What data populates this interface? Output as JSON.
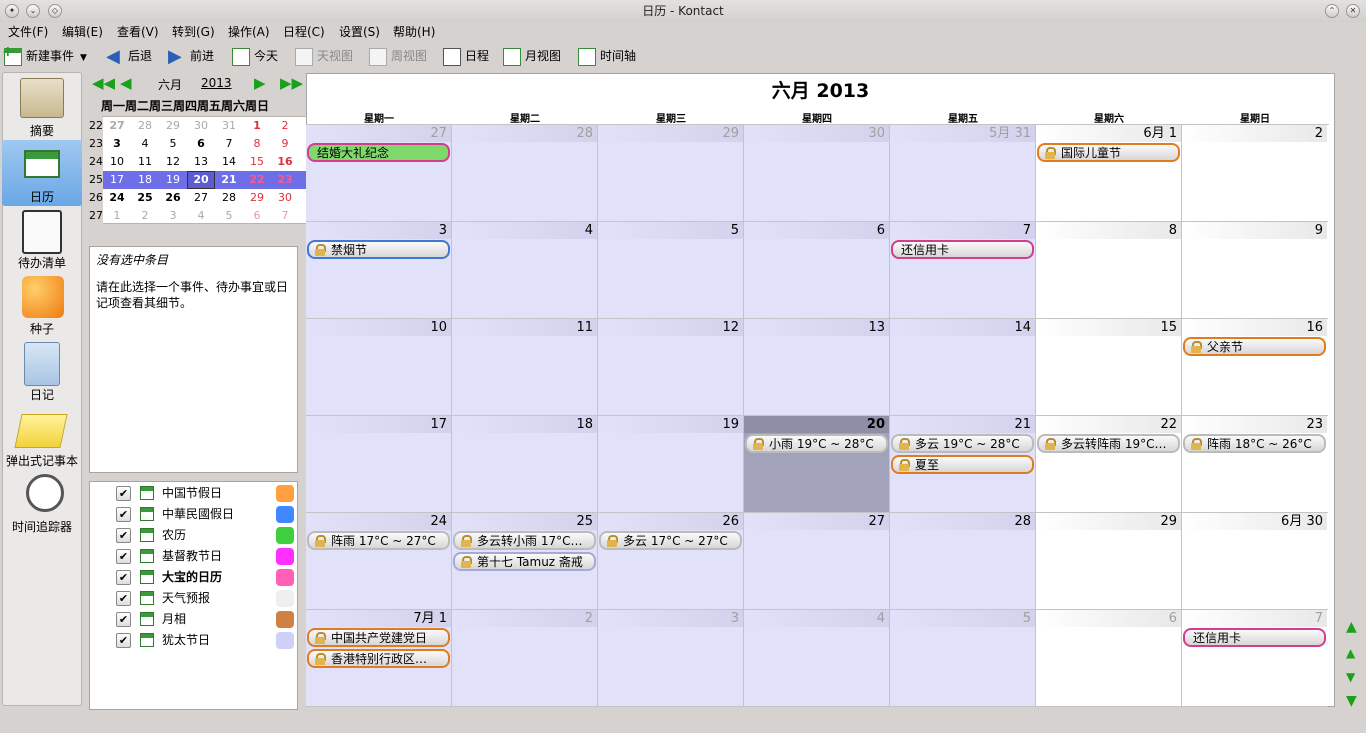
{
  "window": {
    "title": "日历 - Kontact"
  },
  "menu": [
    "文件(F)",
    "编辑(E)",
    "查看(V)",
    "转到(G)",
    "操作(A)",
    "日程(C)",
    "设置(S)",
    "帮助(H)"
  ],
  "toolbar": {
    "new_event": "新建事件",
    "back": "后退",
    "forward": "前进",
    "today": "今天",
    "day_view": "天视图",
    "week_view": "周视图",
    "agenda": "日程",
    "month_view": "月视图",
    "timeline": "时间轴"
  },
  "sidebar": [
    {
      "label": "摘要",
      "icon": "summary-icon"
    },
    {
      "label": "日历",
      "icon": "calendar-icon",
      "selected": true
    },
    {
      "label": "待办清单",
      "icon": "todo-icon"
    },
    {
      "label": "种子",
      "icon": "feed-icon"
    },
    {
      "label": "日记",
      "icon": "journal-icon"
    },
    {
      "label": "弹出式记事本",
      "icon": "notes-icon"
    },
    {
      "label": "时间追踪器",
      "icon": "timetracker-icon"
    }
  ],
  "mini_calendar": {
    "month": "六月",
    "year": "2013",
    "weekday_header": "周一周二周三周四周五周六周日",
    "weeks": [
      {
        "wk": "22",
        "days": [
          "27",
          "28",
          "29",
          "30",
          "31",
          "1",
          "2"
        ]
      },
      {
        "wk": "23",
        "days": [
          "3",
          "4",
          "5",
          "6",
          "7",
          "8",
          "9"
        ]
      },
      {
        "wk": "24",
        "days": [
          "10",
          "11",
          "12",
          "13",
          "14",
          "15",
          "16"
        ]
      },
      {
        "wk": "25",
        "days": [
          "17",
          "18",
          "19",
          "20",
          "21",
          "22",
          "23"
        ]
      },
      {
        "wk": "26",
        "days": [
          "24",
          "25",
          "26",
          "27",
          "28",
          "29",
          "30"
        ]
      },
      {
        "wk": "27",
        "days": [
          "1",
          "2",
          "3",
          "4",
          "5",
          "6",
          "7"
        ]
      }
    ]
  },
  "details": {
    "title": "没有选中条目",
    "line1": "请在此选择一个事件、待办事宜或日",
    "line2": "记项查看其细节。"
  },
  "calendars": [
    {
      "name": "中国节假日",
      "color": "#ff9f3f",
      "checked": true
    },
    {
      "name": "中華民國假日",
      "color": "#3f88ff",
      "checked": true
    },
    {
      "name": "农历",
      "color": "#3fce3f",
      "checked": true
    },
    {
      "name": "基督教节日",
      "color": "#ff30ff",
      "checked": true
    },
    {
      "name": "大宝的日历",
      "color": "#ff5fb4",
      "checked": true,
      "bold": true
    },
    {
      "name": "天气预报",
      "color": "#efefef",
      "checked": true
    },
    {
      "name": "月相",
      "color": "#d08040",
      "checked": true
    },
    {
      "name": "犹太节日",
      "color": "#cfcff7",
      "checked": true
    }
  ],
  "month_view": {
    "title": "六月 2013",
    "weekdays": [
      "星期一",
      "星期二",
      "星期三",
      "星期四",
      "星期五",
      "星期六",
      "星期日"
    ],
    "weeks": [
      [
        "27",
        "28",
        "29",
        "30",
        "5月 31",
        "6月 1",
        "2"
      ],
      [
        "3",
        "4",
        "5",
        "6",
        "7",
        "8",
        "9"
      ],
      [
        "10",
        "11",
        "12",
        "13",
        "14",
        "15",
        "16"
      ],
      [
        "17",
        "18",
        "19",
        "20",
        "21",
        "22",
        "23"
      ],
      [
        "24",
        "25",
        "26",
        "27",
        "28",
        "29",
        "6月 30"
      ],
      [
        "7月 1",
        "2",
        "3",
        "4",
        "5",
        "6",
        "7"
      ]
    ],
    "events": [
      {
        "week": 0,
        "day": 0,
        "slot": 0,
        "text": "结婚大礼纪念",
        "border": "#d63c8c",
        "bg": "#7fd86c",
        "lock": false
      },
      {
        "week": 0,
        "day": 5,
        "slot": 0,
        "text": "国际儿童节",
        "border": "#e07b1f",
        "lock": true
      },
      {
        "week": 1,
        "day": 0,
        "slot": 0,
        "text": "禁烟节",
        "border": "#3f78d8",
        "lock": true
      },
      {
        "week": 1,
        "day": 4,
        "slot": 0,
        "text": "还信用卡",
        "border": "#d63c8c",
        "lock": false
      },
      {
        "week": 2,
        "day": 6,
        "slot": 0,
        "text": "父亲节",
        "border": "#e07b1f",
        "lock": true
      },
      {
        "week": 3,
        "day": 3,
        "slot": 0,
        "text": "小雨 19°C ~ 28°C",
        "border": "#bbbbbb",
        "lock": true
      },
      {
        "week": 3,
        "day": 4,
        "slot": 0,
        "text": "多云 19°C ~ 28°C",
        "border": "#bbbbbb",
        "lock": true
      },
      {
        "week": 3,
        "day": 4,
        "slot": 1,
        "text": "夏至",
        "border": "#e07b1f",
        "lock": true
      },
      {
        "week": 3,
        "day": 5,
        "slot": 0,
        "text": "多云转阵雨 19°C…",
        "border": "#bbbbbb",
        "lock": true
      },
      {
        "week": 3,
        "day": 6,
        "slot": 0,
        "text": "阵雨 18°C ~ 26°C",
        "border": "#bbbbbb",
        "lock": true
      },
      {
        "week": 4,
        "day": 0,
        "slot": 0,
        "text": "阵雨 17°C ~ 27°C",
        "border": "#bbbbbb",
        "lock": true
      },
      {
        "week": 4,
        "day": 1,
        "slot": 0,
        "text": "多云转小雨 17°C…",
        "border": "#bbbbbb",
        "lock": true
      },
      {
        "week": 4,
        "day": 1,
        "slot": 1,
        "text": "第十七 Tamuz 斋戒",
        "border": "#a8a8d8",
        "lock": true
      },
      {
        "week": 4,
        "day": 2,
        "slot": 0,
        "text": "多云 17°C ~ 27°C",
        "border": "#bbbbbb",
        "lock": true
      },
      {
        "week": 5,
        "day": 0,
        "slot": 0,
        "text": "中国共产党建党日",
        "border": "#e07b1f",
        "lock": true
      },
      {
        "week": 5,
        "day": 0,
        "slot": 1,
        "text": "香港特别行政区…",
        "border": "#e07b1f",
        "lock": true
      },
      {
        "week": 5,
        "day": 6,
        "slot": 0,
        "text": "还信用卡",
        "border": "#d63c8c",
        "lock": false
      }
    ]
  }
}
